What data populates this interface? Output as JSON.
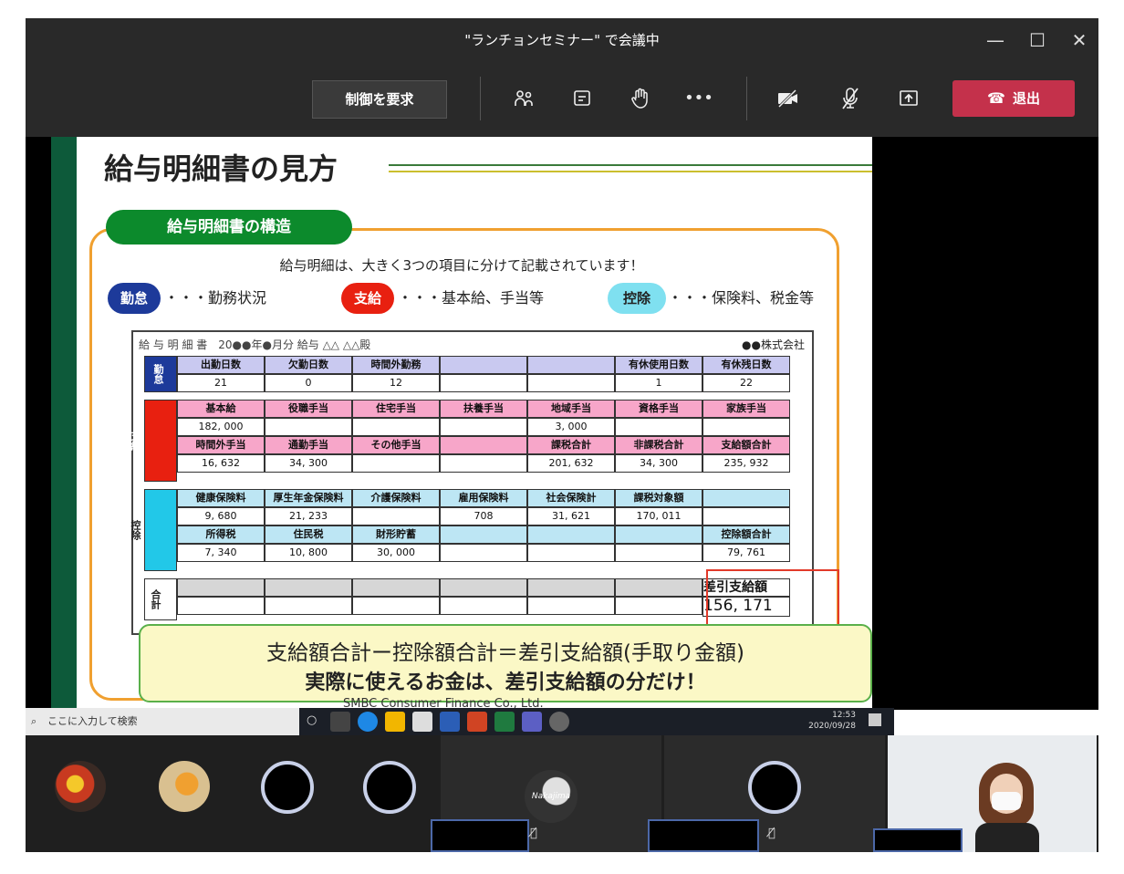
{
  "window": {
    "title": "\"ランチョンセミナー\" で会議中",
    "minimize": "—",
    "maximize": "☐",
    "close": "✕"
  },
  "toolbar": {
    "request_control": "制御を要求",
    "participants_icon": "people-icon",
    "chat_icon": "chat-icon",
    "raise_hand_icon": "raise-hand-icon",
    "more": "•••",
    "camera_off_icon": "camera-off-icon",
    "mic_off_icon": "mic-off-icon",
    "share_icon": "share-icon",
    "leave_label": "退出",
    "leave_color": "#c4314b"
  },
  "slide": {
    "title": "給与明細書の見方",
    "structure_tab": "給与明細書の構造",
    "intro": "給与明細は、大きく3つの項目に分けて記載されています！",
    "categories": [
      {
        "label": "勤怠",
        "desc": "・・・勤務状況",
        "color": "#1d3a9a"
      },
      {
        "label": "支給",
        "desc": "・・・基本給、手当等",
        "color": "#e82010"
      },
      {
        "label": "控除",
        "desc": "・・・保険料、税金等",
        "color": "#7fe0f0"
      }
    ],
    "payslip": {
      "header": "給 与 明 細 書　20●●年●月分 給与 △△ △△殿",
      "company": "●●株式会社",
      "kintai_label": "勤怠",
      "shikyu_label": "支給",
      "koujo_label": "控除",
      "goukei_label": "合計",
      "kintai_headers": [
        "出勤日数",
        "欠勤日数",
        "時間外勤務",
        "",
        "",
        "有休使用日数",
        "有休残日数"
      ],
      "kintai_values": [
        "21",
        "0",
        "12",
        "",
        "",
        "1",
        "22"
      ],
      "shikyu_h1": [
        "基本給",
        "役職手当",
        "住宅手当",
        "扶養手当",
        "地域手当",
        "資格手当",
        "家族手当"
      ],
      "shikyu_v1": [
        "182, 000",
        "",
        "",
        "",
        "3, 000",
        "",
        ""
      ],
      "shikyu_h2": [
        "時間外手当",
        "通勤手当",
        "その他手当",
        "",
        "課税合計",
        "非課税合計",
        "支給額合計"
      ],
      "shikyu_v2": [
        "16, 632",
        "34, 300",
        "",
        "",
        "201, 632",
        "34, 300",
        "235, 932"
      ],
      "koujo_h1": [
        "健康保険料",
        "厚生年金保険料",
        "介護保険料",
        "雇用保険料",
        "社会保険計",
        "課税対象額",
        ""
      ],
      "koujo_v1": [
        "9, 680",
        "21, 233",
        "",
        "708",
        "31, 621",
        "170, 011",
        ""
      ],
      "koujo_h2": [
        "所得税",
        "住民税",
        "財形貯蓄",
        "",
        "",
        "",
        "控除額合計"
      ],
      "koujo_v2": [
        "7, 340",
        "10, 800",
        "30, 000",
        "",
        "",
        "",
        "79, 761"
      ],
      "diff_label": "差引支給額",
      "diff_value": "156, 171"
    },
    "formula": "支給額合計ー控除額合計＝差引支給額(手取り金額)",
    "formula2": "実際に使えるお金は、差引支給額の分だけ！",
    "footer": "SMBC Consumer Finance Co., Ltd."
  },
  "taskbar": {
    "search_placeholder": "ここに入力して検索",
    "time": "12:53",
    "date": "2020/09/28"
  },
  "participants": {
    "tile_label": "Nakajima"
  }
}
